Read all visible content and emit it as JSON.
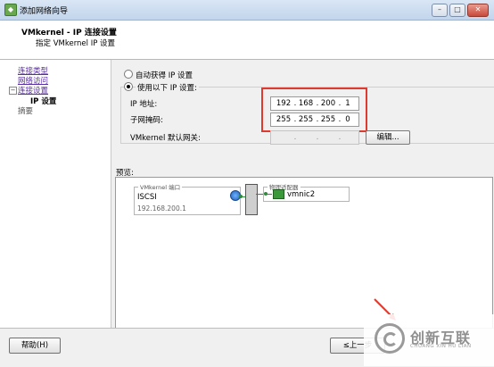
{
  "window": {
    "title": "添加网络向导",
    "min": "–",
    "max": "□",
    "close": "✕",
    "icon": "app-icon"
  },
  "header": {
    "title": "VMkernel - IP 连接设置",
    "subtitle": "指定 VMkernel IP 设置"
  },
  "nav": {
    "items": [
      {
        "label": "连接类型"
      },
      {
        "label": "网络访问"
      },
      {
        "label": "连接设置"
      },
      {
        "label": "IP 设置"
      },
      {
        "label": "摘要"
      }
    ]
  },
  "form": {
    "auto_ip_label": "自动获得 IP 设置",
    "manual_ip_label": "使用以下 IP 设置:",
    "ip_label": "IP 地址:",
    "ip": [
      "192",
      "168",
      "200",
      "1"
    ],
    "mask_label": "子网掩码:",
    "mask": [
      "255",
      "255",
      "255",
      "0"
    ],
    "gateway_label": "VMkernel 默认网关:",
    "gateway": [
      "",
      "",
      "",
      ""
    ],
    "dot": ".",
    "edit_button": "编辑..."
  },
  "preview": {
    "label": "预览:",
    "vmk_group_title": "VMkernel 端口",
    "port_name": "ISCSI",
    "port_ip": "192.168.200.1",
    "adapter_group_title": "物理适配器",
    "adapter_name": "vmnic2"
  },
  "footer": {
    "help_button": "帮助(H)",
    "back_button": "≤上一步"
  },
  "watermark": {
    "cn": "创新互联",
    "en": "CHUANG XIN HU LIAN"
  },
  "colors": {
    "highlight": "#e03a2e",
    "link": "#5a2ea6",
    "nic": "#3a9a3a"
  }
}
